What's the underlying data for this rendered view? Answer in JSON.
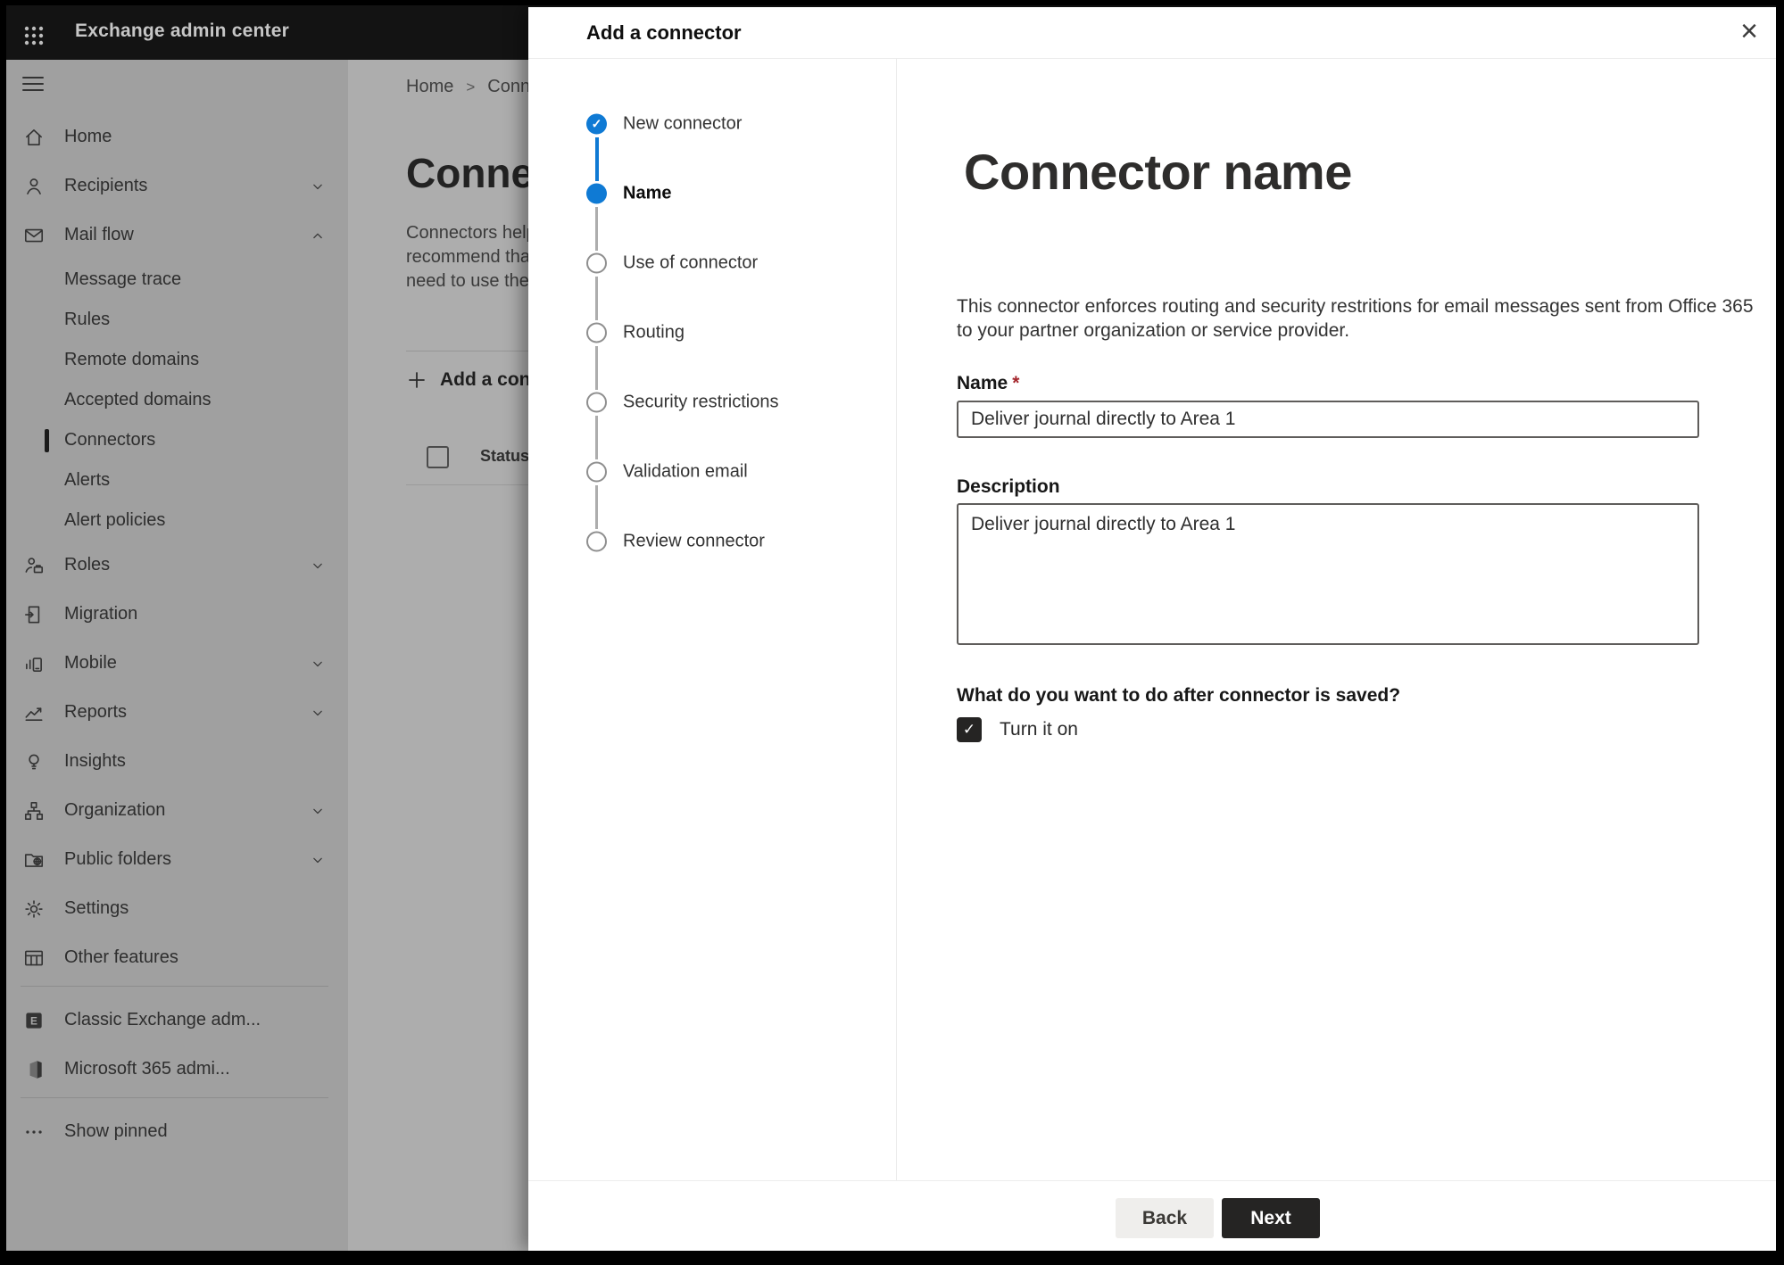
{
  "chrome": {
    "top_bar_title": "Exchange admin center"
  },
  "sidebar": {
    "items": [
      {
        "label": "Home",
        "icon": "home-icon"
      },
      {
        "label": "Recipients",
        "icon": "person-icon",
        "chevron": "down"
      },
      {
        "label": "Mail flow",
        "icon": "mail-icon",
        "chevron": "up"
      },
      {
        "label": "Message trace",
        "indent": true
      },
      {
        "label": "Rules",
        "indent": true
      },
      {
        "label": "Remote domains",
        "indent": true
      },
      {
        "label": "Accepted domains",
        "indent": true
      },
      {
        "label": "Connectors",
        "indent": true,
        "selected": true
      },
      {
        "label": "Alerts",
        "indent": true
      },
      {
        "label": "Alert policies",
        "indent": true
      },
      {
        "label": "Roles",
        "icon": "roles-icon",
        "chevron": "down"
      },
      {
        "label": "Migration",
        "icon": "migration-icon"
      },
      {
        "label": "Mobile",
        "icon": "mobile-icon",
        "chevron": "down"
      },
      {
        "label": "Reports",
        "icon": "reports-icon",
        "chevron": "down"
      },
      {
        "label": "Insights",
        "icon": "insights-icon"
      },
      {
        "label": "Organization",
        "icon": "organization-icon",
        "chevron": "down"
      },
      {
        "label": "Public folders",
        "icon": "public-folders-icon",
        "chevron": "down"
      },
      {
        "label": "Settings",
        "icon": "settings-icon"
      },
      {
        "label": "Other features",
        "icon": "other-features-icon"
      },
      {
        "divider": true
      },
      {
        "label": "Classic Exchange adm...",
        "icon": "classic-exchange-icon"
      },
      {
        "label": "Microsoft 365 admi...",
        "icon": "microsoft-365-icon"
      },
      {
        "divider": true
      },
      {
        "label": "Show pinned",
        "icon": "show-pinned-icon"
      }
    ]
  },
  "background": {
    "breadcrumb": {
      "home": "Home",
      "separator": ">",
      "current": "Conne"
    },
    "title": "Connec",
    "paragraph_lines": [
      "Connectors help",
      "recommend that",
      "need to use ther"
    ],
    "add_button_label": "Add a conn",
    "table": {
      "status_header": "Status"
    }
  },
  "dialog": {
    "title": "Add a connector",
    "close_glyph": "×",
    "steps": [
      {
        "label": "New connector",
        "state": "completed"
      },
      {
        "label": "Name",
        "state": "current"
      },
      {
        "label": "Use of connector",
        "state": "upcoming"
      },
      {
        "label": "Routing",
        "state": "upcoming"
      },
      {
        "label": "Security restrictions",
        "state": "upcoming"
      },
      {
        "label": "Validation email",
        "state": "upcoming"
      },
      {
        "label": "Review connector",
        "state": "upcoming"
      }
    ],
    "content": {
      "heading": "Connector name",
      "description_lines": [
        "This connector enforces routing and security restritions for email messages sent from Office 365",
        "to your partner organization or service provider."
      ],
      "name_label": "Name",
      "required_marker": "*",
      "name_value": "Deliver journal directly to Area 1",
      "description_label": "Description",
      "description_value": "Deliver journal directly to Area 1",
      "after_save_question": "What do you want to do after connector is saved?",
      "turn_on_label": "Turn it on",
      "turn_on_checked": true
    },
    "footer": {
      "back_label": "Back",
      "next_label": "Next"
    }
  },
  "colors": {
    "accent_blue": "#0f7ad4",
    "required_red": "#a4262c",
    "next_button_bg": "#252423",
    "top_bar_bg": "#131313",
    "dimmed_sidebar_bg": "#a0a0a0",
    "dimmed_content_bg": "#adadad"
  }
}
